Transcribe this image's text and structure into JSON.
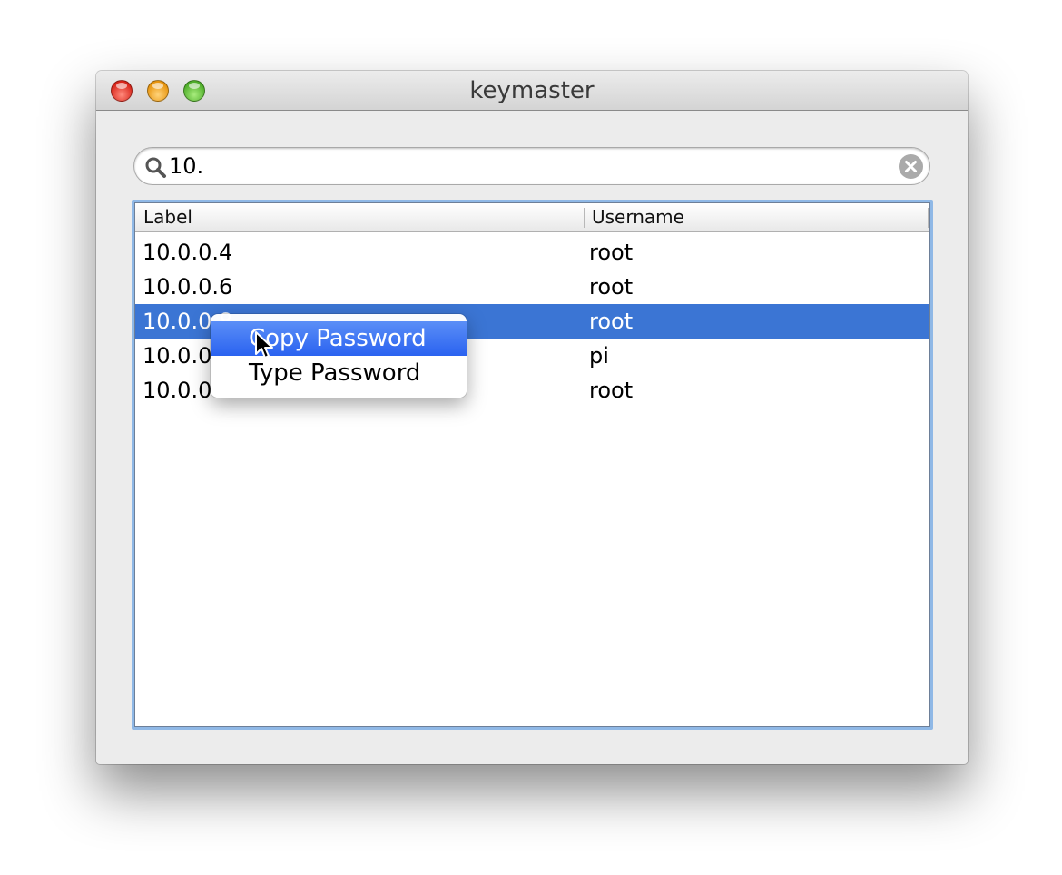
{
  "window": {
    "title": "keymaster"
  },
  "search": {
    "value": "10."
  },
  "table": {
    "columns": [
      "Label",
      "Username"
    ],
    "rows": [
      {
        "label": "10.0.0.4",
        "username": "root"
      },
      {
        "label": "10.0.0.6",
        "username": "root"
      },
      {
        "label": "10.0.0.8",
        "username": "root",
        "selected": true
      },
      {
        "label": "10.0.0",
        "username": "pi"
      },
      {
        "label": "10.0.0",
        "username": "root"
      }
    ]
  },
  "context_menu": {
    "items": [
      {
        "label": "Copy Password",
        "highlighted": true
      },
      {
        "label": "Type Password"
      }
    ]
  },
  "colors": {
    "selection": "#3b75d4",
    "menu_highlight": "#2a62f0",
    "focus_ring": "#8fb8e6"
  },
  "icons": [
    "close-button",
    "minimize-button",
    "zoom-button",
    "search-icon",
    "clear-icon",
    "arrow-cursor-icon"
  ]
}
